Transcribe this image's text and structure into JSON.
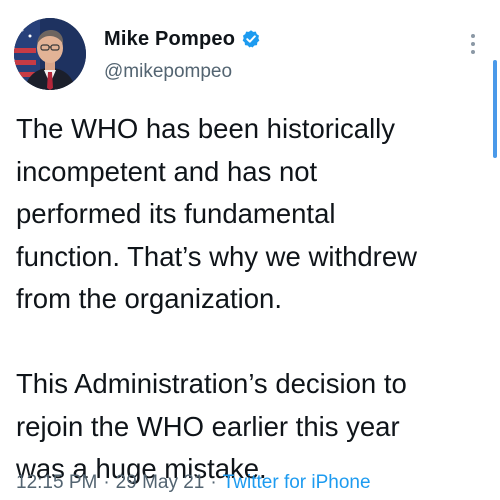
{
  "author": {
    "display_name": "Mike Pompeo",
    "handle": "@mikepompeo",
    "verified": true
  },
  "avatar": {
    "icon": "profile-photo"
  },
  "tweet": {
    "text": "The WHO has been historically\nincompetent and has not\nperformed its fundamental\nfunction. That’s why we withdrew\nfrom the organization.\n\nThis Administration’s decision to\nrejoin the WHO earlier this year\nwas a huge mistake.",
    "time": "12:15 PM",
    "separator1": "·",
    "date": "29 May 21",
    "separator2": "·",
    "source": "Twitter for iPhone"
  },
  "icons": {
    "verified": "verified-badge-icon",
    "more": "more-options-icon"
  },
  "colors": {
    "accent": "#1d9bf0",
    "text": "#0f1419",
    "secondary": "#536471"
  }
}
